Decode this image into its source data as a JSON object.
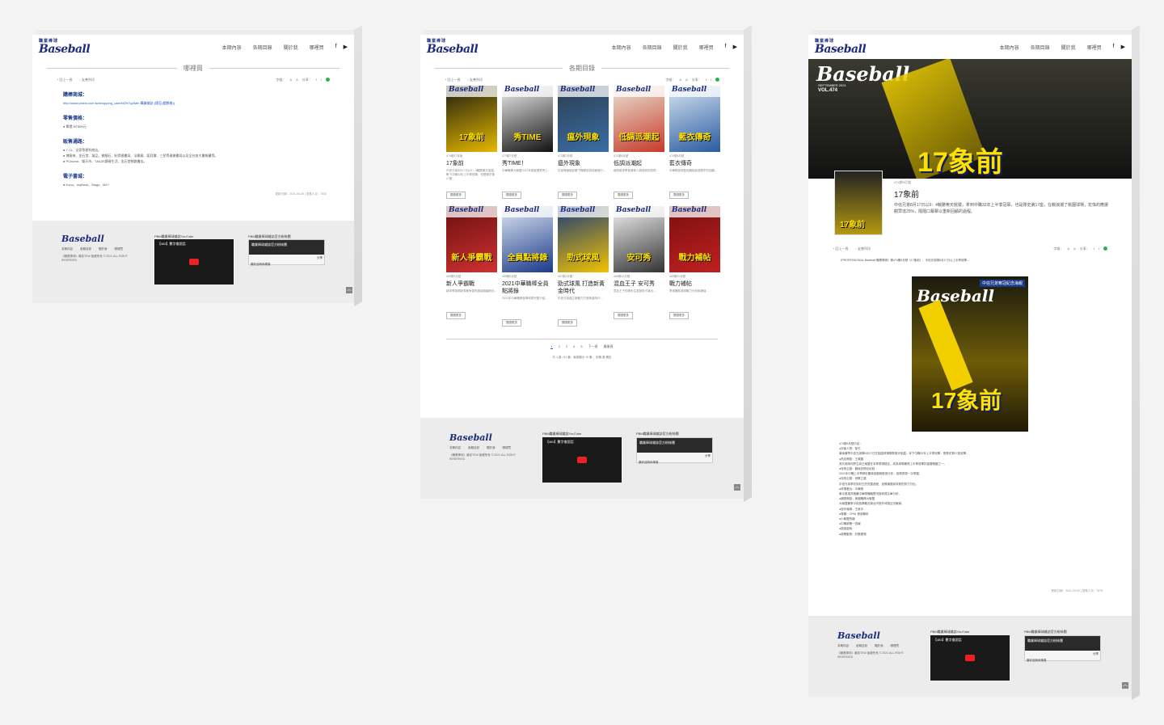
{
  "site": {
    "logo_text": "Baseball",
    "logo_sub": "職業棒球",
    "logo_tag": "PROFESSIONAL",
    "menu": [
      "本期內容",
      "各期目錄",
      "關於我",
      "哪裡買"
    ],
    "social_icons": [
      "facebook-icon",
      "youtube-icon"
    ]
  },
  "colors": {
    "brand_blue": "#1b2a7a",
    "link_blue": "#1b5ad0",
    "line_green": "#2bb34a",
    "cover_yellow": "#ffe100"
  },
  "toolbar": {
    "prev": "回上一頁",
    "print": "友善列印",
    "font_size_label": "字級：",
    "share_label": "分享："
  },
  "where_to_buy": {
    "title": "哪裡買",
    "sections": [
      {
        "heading": "購棒商城：",
        "lines": [
          "http://www.probb.com.tw/shopping_cate/NI2NTg4Mm 購買雜誌 (請至(看數據))"
        ]
      },
      {
        "heading": "零售價格：",
        "lines": [
          "● 單價 NT$99元"
        ]
      },
      {
        "heading": "販售通路：",
        "lines": [
          "● 7-11、全家等便利商店。",
          "● 博客來、金石堂、誠品、墊腳石、紀伊國書局、法雅客、諾貝爾、三民等連鎖書局以及全台各大書報攤等。",
          "● PChome、樂天市、TAAZE讀冊生活、金石堂網路書店。"
        ]
      },
      {
        "heading": "電子書城：",
        "lines": [
          "● Kono、myBook、Magv、MZ+"
        ]
      }
    ],
    "meta": "更新日期：2021-06-08 | 瀏覽人次：7530"
  },
  "catalog": {
    "title": "各期目錄",
    "cards": [
      {
        "issue": "474期17年版",
        "title": "17象前",
        "desc": "中信兄弟8月17日以9：4戰勝樂天桃猿，奪下中職32年上半季冠軍，也是隊史第17座...",
        "more": "閱讀更多",
        "c1": "#1c1c10",
        "c2": "#e6b800",
        "cover_text": "17象前"
      },
      {
        "issue": "473期7月號",
        "title": "秀TIME！",
        "desc": "中華職棒大聯盟2021年首屆選秀會上…",
        "more": "閱讀更多",
        "c1": "#f0f0f0",
        "c2": "#111111",
        "cover_text": "秀TIME"
      },
      {
        "issue": "472期7月號",
        "title": "瘟外現象",
        "desc": "在疫情嚴峻影響下職棒依然持續進行…",
        "more": "閱讀更多",
        "c1": "#2c3e50",
        "c2": "#3a6ea5",
        "cover_text": "瘟外現象"
      },
      {
        "issue": "471期5月號",
        "title": "低調派潮起",
        "desc": "面對新球季各隊新人與老將的表現…",
        "more": "閱讀更多",
        "c1": "#e9e4d4",
        "c2": "#c83a2a",
        "cover_text": "低調派潮起"
      },
      {
        "issue": "470期4月號",
        "title": "藍衣傳奇",
        "desc": "中華隊身穿藍色戰袍創造歷史的回顧…",
        "more": "閱讀更多",
        "c1": "#d7e6f2",
        "c2": "#2a5aa0",
        "cover_text": "藍衣傳奇"
      },
      {
        "issue": "469期3月號",
        "title": "新人爭霸戰",
        "desc": "新球季各隊新秀競爭激烈誰能脫穎而出…",
        "more": "閱讀更多",
        "c1": "#6a1010",
        "c2": "#d03030",
        "cover_text": "新人爭霸戰"
      },
      {
        "issue": "468期2月號",
        "title": "2021中華職棒全員點將錄",
        "desc": "2021年中華職棒各隊球員完整介紹…",
        "more": "閱讀更多",
        "c1": "#dfe8f3",
        "c2": "#1b3a8a",
        "cover_text": "全員點將錄"
      },
      {
        "issue": "467期1月號",
        "title": "勁式球風 打造新黃金時代",
        "desc": "中信兄弟建立新戰力打造黃金時代…",
        "more": "閱讀更多",
        "c1": "#1a3a7a",
        "c2": "#f2c200",
        "cover_text": "勁式球風"
      },
      {
        "issue": "466期12月號",
        "title": "混血王子 安可秀",
        "desc": "混血王子的精彩生涯與安可演出…",
        "more": "閱讀更多",
        "c1": "#f5f5f5",
        "c2": "#333333",
        "cover_text": "安可秀"
      },
      {
        "issue": "465期11月號",
        "title": "戰力補帖",
        "desc": "季後賽前各隊戰力分析與補強…",
        "more": "閱讀更多",
        "c1": "#7a1010",
        "c2": "#c02020",
        "cover_text": "戰力補帖"
      }
    ],
    "pages": [
      "1",
      "2",
      "3",
      "4",
      "5",
      "下一頁",
      "最後頁"
    ],
    "pager_info": "共 1 頁 / 61 筆，每頁顯示 10 筆 ，到第 頁 確定"
  },
  "issue_detail": {
    "hero_issue": "VOL.474",
    "hero_date": "SEPTEMBER 2021",
    "hero_text": "17象前",
    "issue": "474期9月號",
    "title": "17象前",
    "desc": "中信兄弟8月17日以9：4戰勝樂天桃猿，拿到中職32年上半季冠軍，也是隊史第17座，在戰浪潮了桃園球場，宏偉的應援觀眾達25%，隨隨口幕擊以重新回顧的過程。",
    "intro": "《PROFESSIONAL Baseball 職業棒球》第474期9月號《17象前》，中信兄弟隊8月17日以上半季冠軍…",
    "cover_banner": "中信兄弟奪冠紀念海報",
    "cover_text": "17象前",
    "contents_label": "474期9月號內容：",
    "contents": [
      "●封面人物：象先",
      "最後賽季中信兄弟隊8月17日在桃園球場擊敗樂天桃猿，拿下中職32年上半季冠軍，是隊史第17座冠軍。",
      "●熱血焦點：王威晨",
      "其兄弟隊內野主將王威晨在本季表現穩定，成為球隊贏得上半季冠軍的重要關鍵之一。",
      "●特別企劃：賽後訪問全紀錄",
      "2021年中職上半季精彩賽事回顧與數據分析，各隊表現一次掌握。",
      "●特別企劃：冠軍之路",
      "中信兄弟季初到封王的完整過程，從教練團到球員的努力付出。",
      "●球場看台：中華隊",
      "東京奧運資格賽中華隊備戰實況與球員名單分析。",
      "●國際焦點：美國職棒大聯盟",
      "大聯盟賽季中段各隊戰況與台灣旅外球員近況報導。",
      "●旅外報導：王維中",
      "●專欄：CPBL 數據解析",
      "●小聯盟快報",
      "●中職新聞一週報",
      "●讀者園地",
      "●新聞動態：好戲連場"
    ],
    "meta": "更新日期：2021-09-02 | 瀏覽人次：7575"
  },
  "footer": {
    "logo": "Baseball",
    "links": [
      "本期內容",
      "各期目錄",
      "關於我",
      "哪裡買"
    ],
    "copyright": "《職業棒球》雜誌TEW 版權所有 © 2021 ALL RIGHT RESERVED",
    "yt_title": "PBM職業棒球雜誌YouTube",
    "fb_title": "PBM職業棒球雜誌官方粉絲團",
    "yt_video": "【483】數字會說話",
    "fb_page": "職業棒球雜誌官方粉絲團",
    "fb_like": "讚好此粉絲專頁",
    "fb_share": "分享"
  }
}
